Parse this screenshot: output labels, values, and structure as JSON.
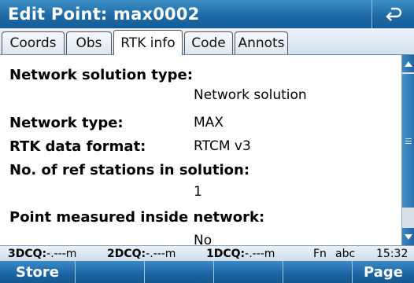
{
  "title": "Edit Point:  max0002",
  "tabs": [
    {
      "label": "Coords"
    },
    {
      "label": "Obs"
    },
    {
      "label": "RTK info"
    },
    {
      "label": "Code"
    },
    {
      "label": "Annots"
    }
  ],
  "active_tab": "RTK info",
  "fields": {
    "network_solution_type": {
      "label": "Network solution type:",
      "value": "Network solution"
    },
    "network_type": {
      "label": "Network type:",
      "value": "MAX"
    },
    "rtk_data_format": {
      "label": "RTK data format:",
      "value": "RTCM v3"
    },
    "ref_stations": {
      "label": "No. of ref stations in solution:",
      "value": "1"
    },
    "inside_network": {
      "label": "Point measured inside network:",
      "value": "No"
    }
  },
  "status": {
    "dcq3_label": "3DCQ:",
    "dcq3_value": "-.---m",
    "dcq2_label": "2DCQ:",
    "dcq2_value": "-.---m",
    "dcq1_label": "1DCQ:",
    "dcq1_value": "-.---m",
    "fn": "Fn",
    "input_mode": "abc",
    "time": "15:32"
  },
  "softkeys": {
    "store": "Store",
    "page": "Page"
  },
  "colors": {
    "titlebar": "#1e6aa6",
    "softkeys": "#1b64a1",
    "tabstrip": "#d2e2ef"
  }
}
